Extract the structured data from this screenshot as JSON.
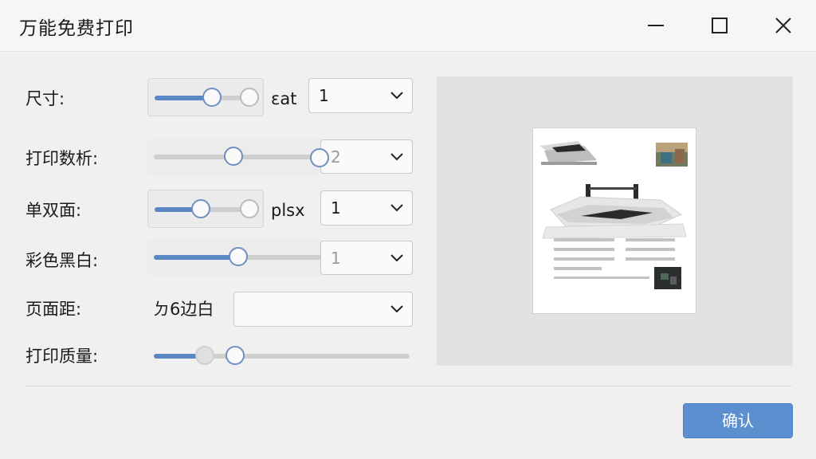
{
  "window": {
    "title": "万能免费打印"
  },
  "rows": {
    "size": {
      "label": "尺寸:",
      "mid_text": "ɛat",
      "select_value": "1",
      "slider_level": 0.56
    },
    "copies": {
      "label": "打印数析:",
      "select_value": "2",
      "slider_level": 0.46
    },
    "duplex": {
      "label": "单双面:",
      "mid_text": "plsx",
      "select_value": "1",
      "slider_level": 0.45
    },
    "color": {
      "label": "彩色黑白:",
      "select_value": "1",
      "slider_level": 0.5
    },
    "margin": {
      "label": "页面距:",
      "mid_text": "ㄉ6边白",
      "select_value": ""
    },
    "quality": {
      "label": "打印质量:",
      "slider_level": 0.2
    }
  },
  "footer": {
    "ok_label": "确认"
  },
  "colors": {
    "accent": "#5b8fd0",
    "slider_fill": "#5b87c5"
  }
}
